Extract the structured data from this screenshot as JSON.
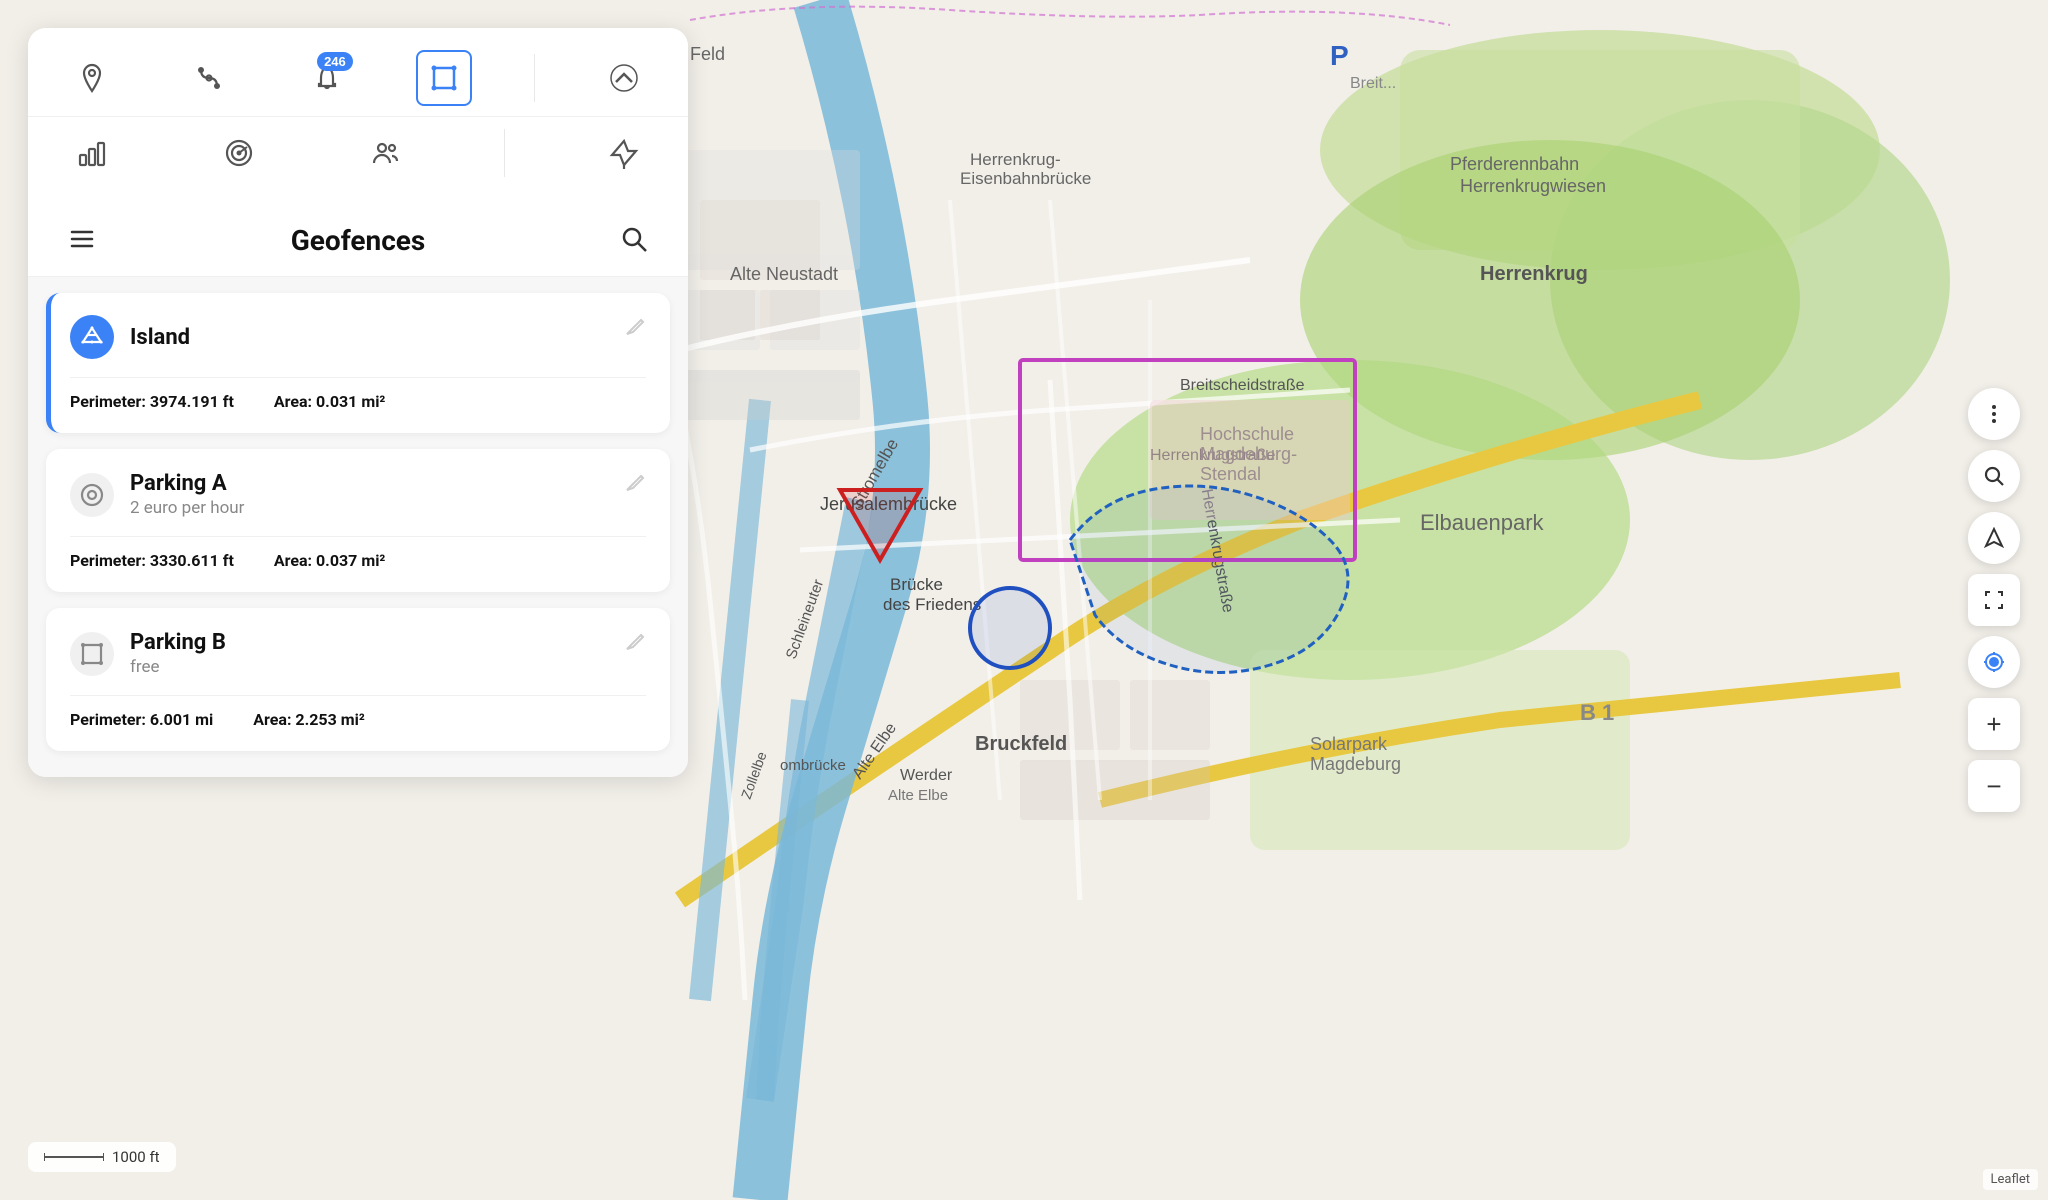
{
  "toolbar": {
    "icons": [
      {
        "name": "location-pin-icon",
        "label": "Location Pin",
        "row": 1
      },
      {
        "name": "route-icon",
        "label": "Route",
        "row": 1
      },
      {
        "name": "notification-icon",
        "label": "Notifications",
        "badge": "246",
        "row": 1
      },
      {
        "name": "geofence-icon",
        "label": "Geofences",
        "active": true,
        "row": 1
      },
      {
        "name": "chevron-up-icon",
        "label": "Collapse",
        "row": 1
      },
      {
        "name": "analytics-icon",
        "label": "Analytics",
        "row": 2
      },
      {
        "name": "settings-icon",
        "label": "Settings",
        "row": 2
      },
      {
        "name": "group-icon",
        "label": "Groups",
        "row": 2
      },
      {
        "name": "pin-icon",
        "label": "Pin",
        "row": 2
      }
    ]
  },
  "geofences_panel": {
    "title": "Geofences",
    "menu_label": "Menu",
    "search_label": "Search"
  },
  "geofences": [
    {
      "id": "island",
      "name": "Island",
      "subtitle": "",
      "icon_type": "blue",
      "icon_label": "geofence-polygon",
      "active": true,
      "perimeter": "3974.191 ft",
      "area": "0.031 mi²",
      "perimeter_label": "Perimeter:",
      "area_label": "Area:"
    },
    {
      "id": "parking-a",
      "name": "Parking A",
      "subtitle": "2 euro per hour",
      "icon_type": "gray",
      "icon_label": "geofence-circle",
      "active": false,
      "perimeter": "3330.611 ft",
      "area": "0.037 mi²",
      "perimeter_label": "Perimeter:",
      "area_label": "Area:"
    },
    {
      "id": "parking-b",
      "name": "Parking B",
      "subtitle": "free",
      "icon_type": "gray",
      "icon_label": "geofence-polygon2",
      "active": false,
      "perimeter": "6.001 mi",
      "area": "2.253 mi²",
      "perimeter_label": "Perimeter:",
      "area_label": "Area:"
    }
  ],
  "map_controls": {
    "search_label": "Search map",
    "navigation_label": "Navigation",
    "focus_label": "Focus",
    "locate_label": "Locate me",
    "zoom_in_label": "+",
    "zoom_out_label": "−"
  },
  "scale_bar": {
    "value": "1000 ft"
  },
  "attribution": "Leaflet"
}
